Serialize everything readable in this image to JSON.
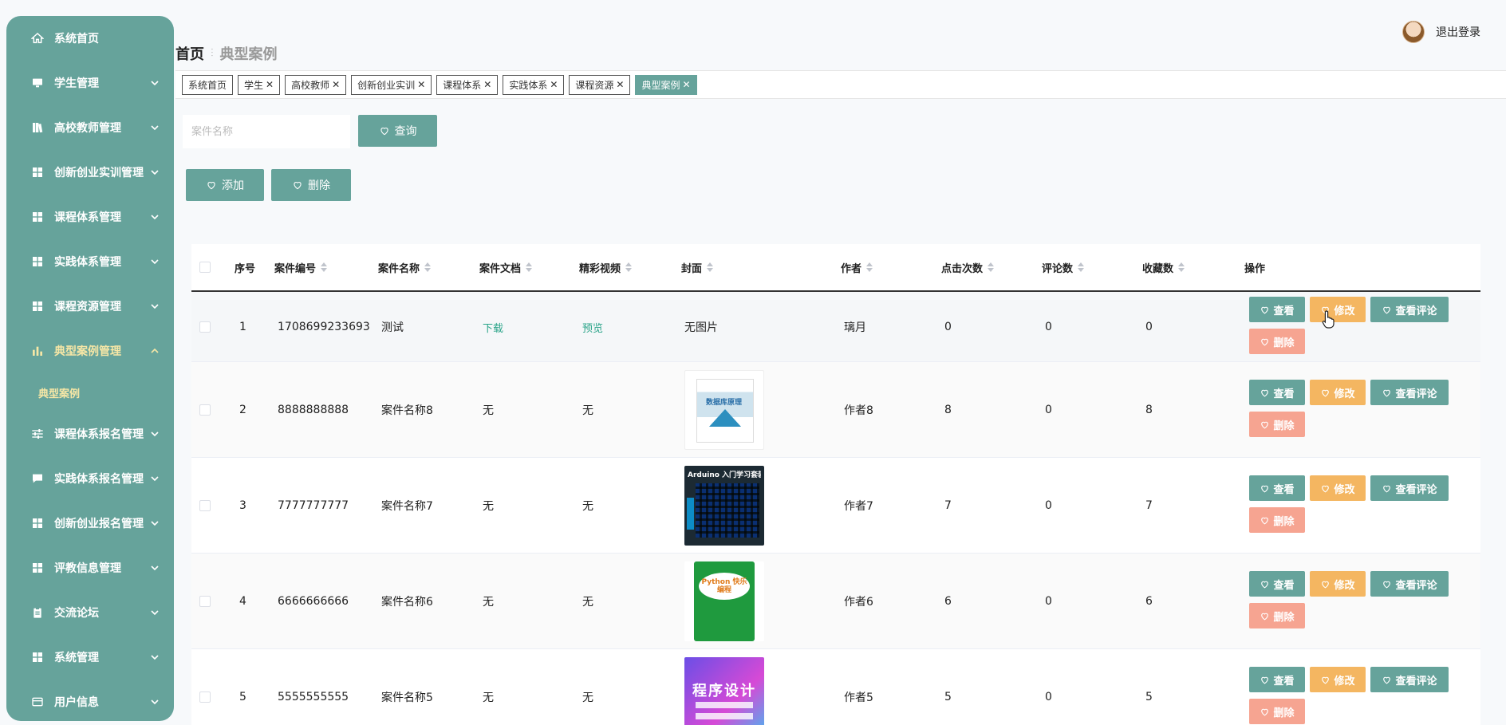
{
  "sidebar": {
    "items": [
      {
        "label": "系统首页",
        "icon": "home-icon",
        "chevron": false
      },
      {
        "label": "学生管理",
        "icon": "monitor-icon",
        "chevron": true
      },
      {
        "label": "高校教师管理",
        "icon": "book-icon",
        "chevron": true
      },
      {
        "label": "创新创业实训管理",
        "icon": "grid-icon",
        "chevron": true
      },
      {
        "label": "课程体系管理",
        "icon": "grid-icon",
        "chevron": true
      },
      {
        "label": "实践体系管理",
        "icon": "grid-icon",
        "chevron": true
      },
      {
        "label": "课程资源管理",
        "icon": "grid-icon",
        "chevron": true
      },
      {
        "label": "典型案例管理",
        "icon": "bar-chart-icon",
        "chevron": true,
        "active": true
      },
      {
        "label": "课程体系报名管理",
        "icon": "sliders-icon",
        "chevron": true
      },
      {
        "label": "实践体系报名管理",
        "icon": "chat-icon",
        "chevron": true
      },
      {
        "label": "创新创业报名管理",
        "icon": "grid-icon",
        "chevron": true
      },
      {
        "label": "评教信息管理",
        "icon": "grid-icon",
        "chevron": true
      },
      {
        "label": "交流论坛",
        "icon": "clipboard-icon",
        "chevron": true
      },
      {
        "label": "系统管理",
        "icon": "grid-icon",
        "chevron": true
      },
      {
        "label": "用户信息",
        "icon": "card-icon",
        "chevron": true
      }
    ],
    "submenu_label": "典型案例"
  },
  "header": {
    "breadcrumb_home": "首页",
    "breadcrumb_current": "典型案例",
    "logout": "退出登录"
  },
  "tags": [
    "系统首页",
    "学生",
    "高校教师",
    "创新创业实训",
    "课程体系",
    "实践体系",
    "课程资源",
    "典型案例"
  ],
  "search": {
    "placeholder": "案件名称",
    "button": "查询"
  },
  "toolbar": {
    "add": "添加",
    "delete": "删除"
  },
  "table": {
    "headers": [
      "序号",
      "案件编号",
      "案件名称",
      "案件文档",
      "精彩视频",
      "封面",
      "作者",
      "点击次数",
      "评论数",
      "收藏数",
      "操作"
    ],
    "rows": [
      {
        "no": "1",
        "code": "1708699233693",
        "name": "测试",
        "doc": "下载",
        "video": "预览",
        "cover": "无图片",
        "author": "璃月",
        "clicks": "0",
        "comments": "0",
        "favs": "0"
      },
      {
        "no": "2",
        "code": "8888888888",
        "name": "案件名称8",
        "doc": "无",
        "video": "无",
        "cover": "数据库原理",
        "author": "作者8",
        "clicks": "8",
        "comments": "0",
        "favs": "8"
      },
      {
        "no": "3",
        "code": "7777777777",
        "name": "案件名称7",
        "doc": "无",
        "video": "无",
        "cover": "Arduino 入门学习套装",
        "author": "作者7",
        "clicks": "7",
        "comments": "0",
        "favs": "7"
      },
      {
        "no": "4",
        "code": "6666666666",
        "name": "案件名称6",
        "doc": "无",
        "video": "无",
        "cover": "Python 快乐编程",
        "author": "作者6",
        "clicks": "6",
        "comments": "0",
        "favs": "6"
      },
      {
        "no": "5",
        "code": "5555555555",
        "name": "案件名称5",
        "doc": "无",
        "video": "无",
        "cover": "程序设计",
        "author": "作者5",
        "clicks": "5",
        "comments": "0",
        "favs": "5"
      }
    ],
    "ops": {
      "view": "查看",
      "edit": "修改",
      "comments": "查看评论",
      "delete": "删除"
    }
  },
  "colors": {
    "primary": "#66a39b",
    "edit": "#f4b661",
    "danger": "#f6a491",
    "active_menu": "#f7e7a6",
    "link": "#2aa489"
  }
}
